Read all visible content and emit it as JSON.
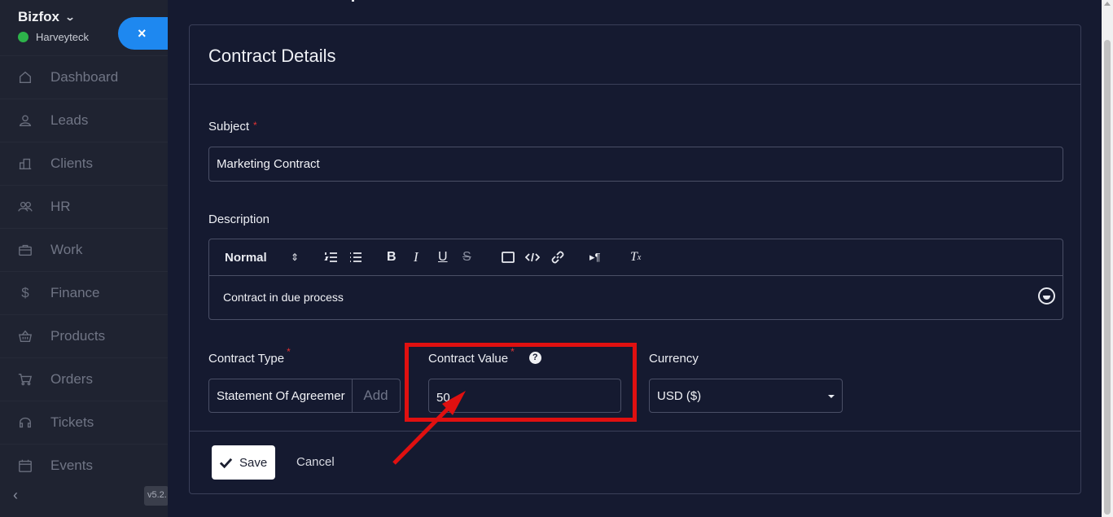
{
  "sidebar": {
    "brand": "Bizfox",
    "workspace": "Harveyteck",
    "close_label": "×",
    "version": "v5.2.",
    "items": [
      {
        "label": "Dashboard",
        "icon": "home-icon"
      },
      {
        "label": "Leads",
        "icon": "user-icon"
      },
      {
        "label": "Clients",
        "icon": "building-icon"
      },
      {
        "label": "HR",
        "icon": "people-icon"
      },
      {
        "label": "Work",
        "icon": "briefcase-icon"
      },
      {
        "label": "Finance",
        "icon": "dollar-icon"
      },
      {
        "label": "Products",
        "icon": "basket-icon"
      },
      {
        "label": "Orders",
        "icon": "cart-icon"
      },
      {
        "label": "Tickets",
        "icon": "headset-icon"
      },
      {
        "label": "Events",
        "icon": "calendar-icon"
      }
    ]
  },
  "form": {
    "title": "Contract Details",
    "subject_label": "Subject",
    "subject_value": "Marketing Contract",
    "description_label": "Description",
    "editor_format": "Normal",
    "description_value": "Contract in due process",
    "contract_type_label": "Contract Type",
    "contract_type_value": "Statement Of Agreemer",
    "add_label": "Add",
    "contract_value_label": "Contract Value",
    "contract_value": "50",
    "currency_label": "Currency",
    "currency_value": "USD ($)",
    "required_mark": "*",
    "help_mark": "?",
    "save_label": "Save",
    "cancel_label": "Cancel"
  },
  "colors": {
    "highlight": "#e01010",
    "accent": "#1e88f0",
    "status": "#2db34a"
  }
}
